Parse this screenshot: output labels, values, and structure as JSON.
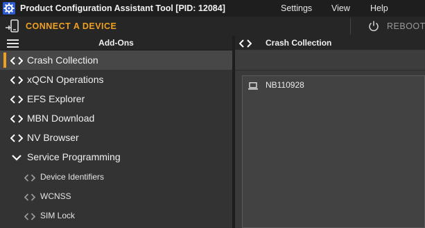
{
  "window": {
    "title": "Product Configuration Assistant Tool [PID: 12084]"
  },
  "menu": {
    "items": [
      "Settings",
      "View",
      "Help"
    ]
  },
  "devicebar": {
    "connect_label": "CONNECT A DEVICE",
    "reboot_label": "REBOOT"
  },
  "sidebar": {
    "title": "Add-Ons",
    "items": [
      {
        "label": "Crash Collection",
        "active": true
      },
      {
        "label": "xQCN Operations"
      },
      {
        "label": "EFS Explorer"
      },
      {
        "label": "MBN Download"
      },
      {
        "label": "NV Browser"
      },
      {
        "label": "Service Programming",
        "expanded": true
      },
      {
        "label": "Device Identifiers",
        "level": 2
      },
      {
        "label": "WCNSS",
        "level": 2
      },
      {
        "label": "SIM Lock",
        "level": 2
      }
    ]
  },
  "panel": {
    "title": "Crash Collection",
    "devices": [
      {
        "name": "NB110928",
        "icon": "laptop-icon"
      }
    ]
  },
  "colors": {
    "accent": "#f0a020",
    "background": "#333333"
  }
}
